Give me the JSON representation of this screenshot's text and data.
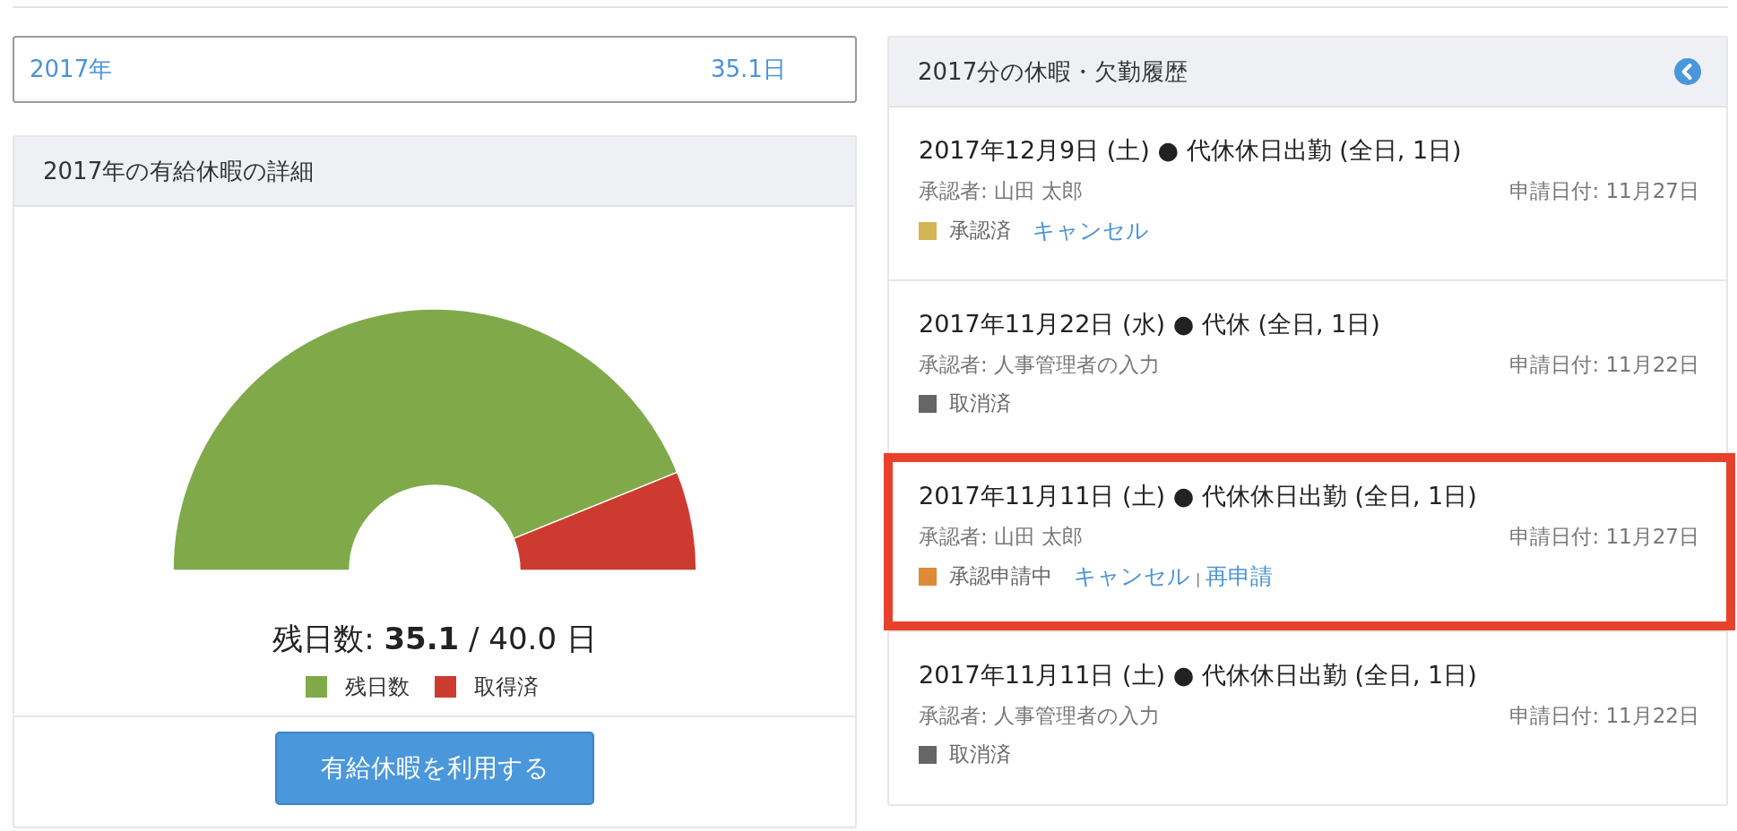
{
  "year_summary": {
    "year": "2017年",
    "days": "35.1日"
  },
  "details_panel": {
    "title": "2017年の有給休暇の詳細",
    "chart_data": {
      "type": "donut",
      "categories": [
        "残日数",
        "取得済"
      ],
      "values": [
        87.75,
        12.25
      ],
      "colors": [
        "#80aa4a",
        "#cd3b30"
      ]
    },
    "summary": {
      "label": "残日数:",
      "remaining": "35.1",
      "total": "/ 40.0 日"
    },
    "button": "有給休暇を利用する"
  },
  "history_panel": {
    "title": "2017分の休暇・欠勤履歴",
    "items": [
      {
        "title": "2017年12月9日 (土) ● 代休休日出勤 (全日, 1日)",
        "approver": "承認者: 山田 太郎",
        "applied": "申請日付: 11月27日",
        "status": "承認済",
        "color": "#d4b455",
        "highlighted": false,
        "actions": [
          {
            "kind": "link",
            "label": "キャンセル"
          }
        ]
      },
      {
        "title": "2017年11月22日 (水) ● 代休 (全日, 1日)",
        "approver": "承認者: 人事管理者の入力",
        "applied": "申請日付: 11月22日",
        "status": "取消済",
        "color": "#666666",
        "highlighted": false
      },
      {
        "title": "2017年11月11日 (土) ● 代休休日出勤 (全日, 1日)",
        "approver": "承認者: 山田 太郎",
        "applied": "申請日付: 11月27日",
        "status": "承認申請中",
        "color": "#de8b38",
        "highlighted": true,
        "actions": [
          {
            "kind": "link",
            "label": "キャンセル"
          },
          {
            "kind": "separator",
            "label": "|"
          },
          {
            "kind": "link",
            "label": "再申請"
          }
        ]
      },
      {
        "title": "2017年11月11日 (土) ● 代休休日出勤 (全日, 1日)",
        "approver": "承認者: 人事管理者の入力",
        "applied": "申請日付: 11月22日",
        "status": "取消済",
        "color": "#666666",
        "highlighted": false
      }
    ]
  }
}
